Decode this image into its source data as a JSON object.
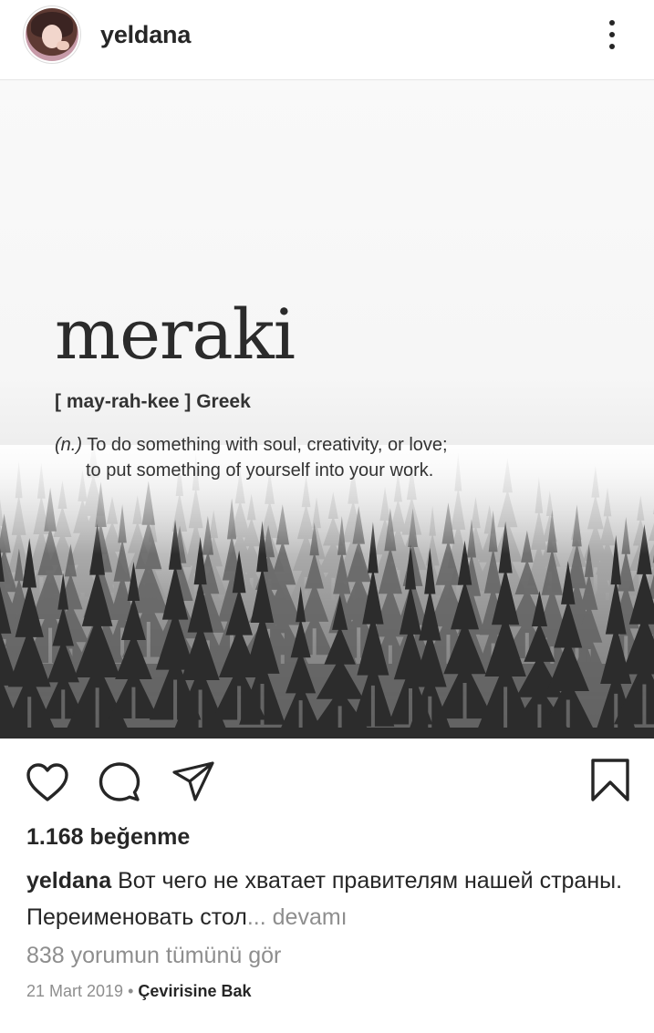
{
  "post": {
    "username": "yeldana",
    "likes": "1.168 beğenme",
    "caption_user": "yeldana",
    "caption_text": "Вот чего не хватает правителям нашей страны. Переименовать стол",
    "caption_ellipsis": "...",
    "more_label": "devamı",
    "view_comments": "838 yorumun tümünü gör",
    "date": "21 Mart 2019",
    "separator": "•",
    "translate_label": "Çevirisine Bak"
  },
  "image": {
    "word": "meraki",
    "pronunciation": "[ may-rah-kee ] Greek",
    "part_of_speech": "(n.)",
    "definition_line1": "To do something with soul, creativity, or love;",
    "definition_line2": "to put something of yourself into your work."
  },
  "icons": {
    "header_menu": "more-vertical-icon",
    "like": "heart-icon",
    "comment": "comment-icon",
    "share": "send-icon",
    "save": "bookmark-icon"
  },
  "colors": {
    "text": "#262626",
    "muted": "#8e8e8e",
    "border": "#e6e6e6"
  }
}
